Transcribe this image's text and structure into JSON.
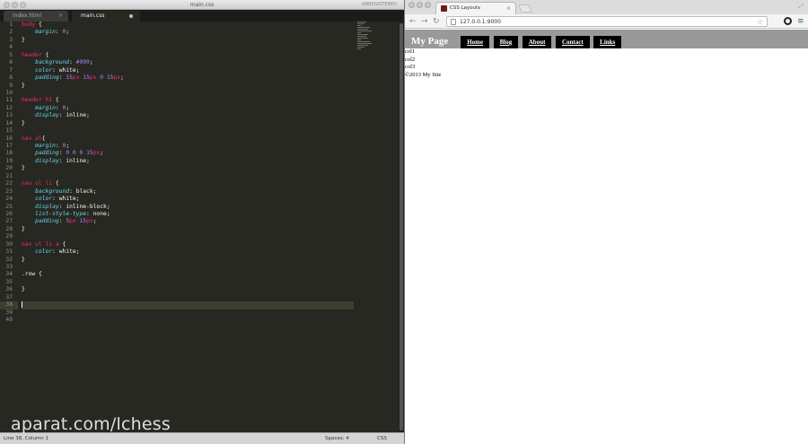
{
  "editor": {
    "window_title": "main.css",
    "registration": "UNREGISTERED",
    "tabs": [
      {
        "label": "index.html",
        "close": "×"
      },
      {
        "label": "main.css"
      }
    ],
    "line_numbers": [
      "1",
      "2",
      "3",
      "4",
      "5",
      "6",
      "7",
      "8",
      "9",
      "10",
      "11",
      "12",
      "13",
      "14",
      "15",
      "16",
      "17",
      "18",
      "19",
      "20",
      "21",
      "22",
      "23",
      "24",
      "25",
      "26",
      "27",
      "28",
      "29",
      "30",
      "31",
      "32",
      "33",
      "34",
      "35",
      "36",
      "37",
      "38",
      "39",
      "40"
    ],
    "code": {
      "l1_sel": "body",
      "l1_brace": " {",
      "l2_prop": "margin",
      "l2_val": "0",
      "close": "}",
      "l5_sel": "header",
      "l5_brace": " {",
      "l6_prop": "background",
      "l6_val": "#999",
      "l7_prop": "color",
      "l7_val": "white",
      "l8_prop": "padding",
      "l8_n1": "15",
      "l8_u1": "px",
      "l8_n2": "15",
      "l8_u2": "px",
      "l8_n3": "0",
      "l8_n4": "15",
      "l8_u4": "px",
      "l11_sel": "header h1",
      "l11_brace": " {",
      "l12_prop": "margin",
      "l12_val": "0",
      "l13_prop": "display",
      "l13_val": "inline",
      "l16_sel": "nav ul",
      "l16_brace": "{",
      "l17_prop": "margin",
      "l17_val": "0",
      "l18_prop": "padding",
      "l18_n1": "0",
      "l18_n2": "0",
      "l18_n3": "0",
      "l18_n4": "15",
      "l18_u4": "px",
      "l19_prop": "display",
      "l19_val": "inline",
      "l22_sel": "nav ul li",
      "l22_brace": " {",
      "l23_prop": "background",
      "l23_val": "black",
      "l24_prop": "color",
      "l24_val": "white",
      "l25_prop": "display",
      "l25_val": "inline-block",
      "l26_prop": "list-style-type",
      "l26_val": "none",
      "l27_prop": "padding",
      "l27_n1": "5",
      "l27_u1": "px",
      "l27_n2": "15",
      "l27_u2": "px",
      "l30_sel": "nav ul li a",
      "l30_brace": " {",
      "l31_prop": "color",
      "l31_val": "white",
      "l34_sel": ".row",
      "l34_brace": " {"
    },
    "status": {
      "position": "Line 38, Column 1",
      "spaces": "Spaces: 4",
      "syntax": "CSS"
    }
  },
  "browser": {
    "tab_title": "CSS Layouts",
    "tab_close": "×",
    "url": "127.0.0.1:9000",
    "nav_back": "←",
    "nav_forward": "→",
    "nav_reload": "↻",
    "star": "☆",
    "menu": "≡",
    "page": {
      "site_title": "My Page",
      "nav": [
        "Home",
        "Blog",
        "About",
        "Contact",
        "Links"
      ],
      "cols": [
        "col1",
        "col2",
        "col3"
      ],
      "footer": "©2013 My Site"
    }
  },
  "watermark": "aparat.com/lchess"
}
